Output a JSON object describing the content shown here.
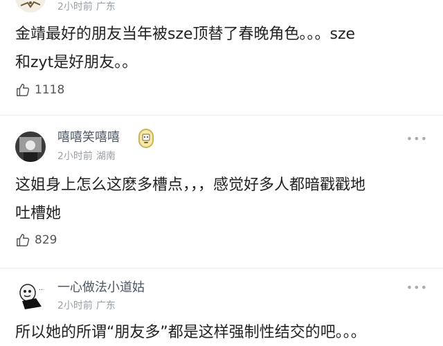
{
  "comments": [
    {
      "time": "2小时前",
      "location": "广东",
      "text_lines": [
        "金靖最好的朋友当年被sze顶替了春晚角色。。。sze",
        "和zyt是好朋友。。"
      ],
      "likes": "1118"
    },
    {
      "username": "嘻嘻笑嘻嘻",
      "badge_icon": "cartoon-badge-icon",
      "time": "2小时前",
      "location": "湖南",
      "more": "•••",
      "text_lines": [
        "这姐身上怎么这麽多槽点，，，感觉好多人都暗戳戳地",
        "吐槽她"
      ],
      "likes": "829"
    },
    {
      "username": "一心做法小道姑",
      "time": "2小时前",
      "location": "广东",
      "more": "•••",
      "text_lines": [
        "所以她的所谓“朋友多”都是这样强制性结交的吧。。。"
      ]
    }
  ],
  "colors": {
    "username": "#4d5565",
    "meta": "#9aa0a8",
    "body_text": "#222222",
    "divider": "#ececec"
  }
}
